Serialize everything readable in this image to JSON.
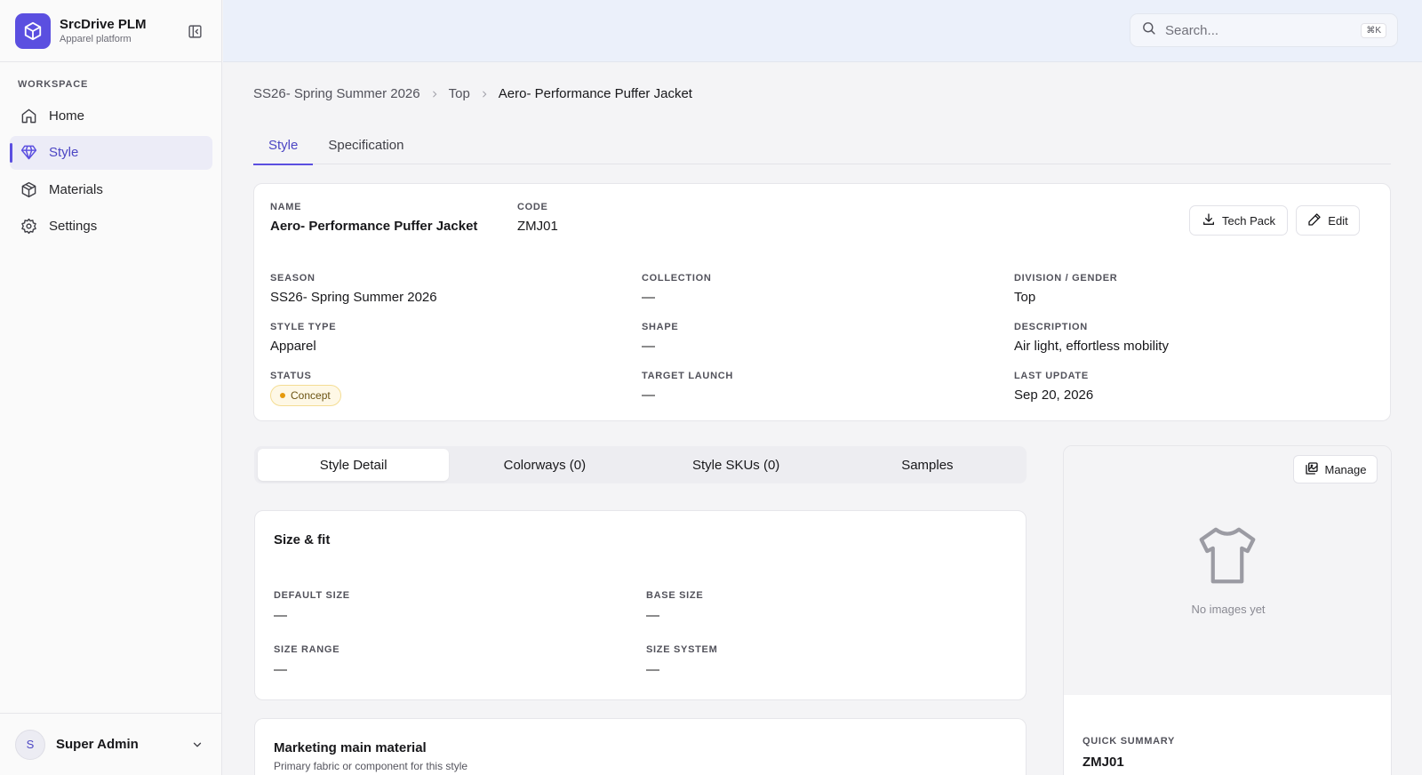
{
  "brand": {
    "name": "SrcDrive PLM",
    "subtitle": "Apparel platform"
  },
  "sidebar": {
    "section_label": "WORKSPACE",
    "items": [
      {
        "label": "Home",
        "icon": "home-icon",
        "active": false
      },
      {
        "label": "Style",
        "icon": "diamond-icon",
        "active": true
      },
      {
        "label": "Materials",
        "icon": "box-icon",
        "active": false
      },
      {
        "label": "Settings",
        "icon": "gear-icon",
        "active": false
      }
    ],
    "user": {
      "initial": "S",
      "name": "Super Admin"
    }
  },
  "search": {
    "placeholder": "Search...",
    "shortcut": "⌘K"
  },
  "breadcrumb": [
    "SS26- Spring Summer 2026",
    "Top",
    "Aero- Performance Puffer Jacket"
  ],
  "tabs": [
    {
      "label": "Style",
      "active": true
    },
    {
      "label": "Specification",
      "active": false
    }
  ],
  "style": {
    "name_label": "NAME",
    "name": "Aero- Performance Puffer Jacket",
    "code_label": "CODE",
    "code": "ZMJ01",
    "tech_pack_label": "Tech Pack",
    "edit_label": "Edit",
    "season_label": "SEASON",
    "season": "SS26- Spring Summer 2026",
    "collection_label": "COLLECTION",
    "collection": "—",
    "division_label": "DIVISION / GENDER",
    "division": "Top",
    "style_type_label": "STYLE TYPE",
    "style_type": "Apparel",
    "shape_label": "SHAPE",
    "shape": "—",
    "description_label": "DESCRIPTION",
    "description": "Air light, effortless mobility",
    "status_label": "STATUS",
    "status": "Concept",
    "target_launch_label": "TARGET LAUNCH",
    "target_launch": "—",
    "last_update_label": "LAST UPDATE",
    "last_update": "Sep 20, 2026"
  },
  "subtabs": [
    {
      "label": "Style Detail",
      "active": true
    },
    {
      "label": "Colorways (0)",
      "active": false
    },
    {
      "label": "Style SKUs (0)",
      "active": false
    },
    {
      "label": "Samples",
      "active": false
    }
  ],
  "size_fit": {
    "title": "Size & fit",
    "default_size_label": "DEFAULT SIZE",
    "default_size": "—",
    "base_size_label": "BASE SIZE",
    "base_size": "—",
    "size_range_label": "SIZE RANGE",
    "size_range": "—",
    "size_system_label": "SIZE SYSTEM",
    "size_system": "—"
  },
  "marketing": {
    "title": "Marketing main material",
    "subtitle": "Primary fabric or component for this style"
  },
  "images": {
    "manage_label": "Manage",
    "empty_text": "No images yet",
    "summary_label": "QUICK SUMMARY",
    "summary_value": "ZMJ01"
  },
  "colors": {
    "accent": "#5b4fe0",
    "status": "#e59a0d"
  }
}
